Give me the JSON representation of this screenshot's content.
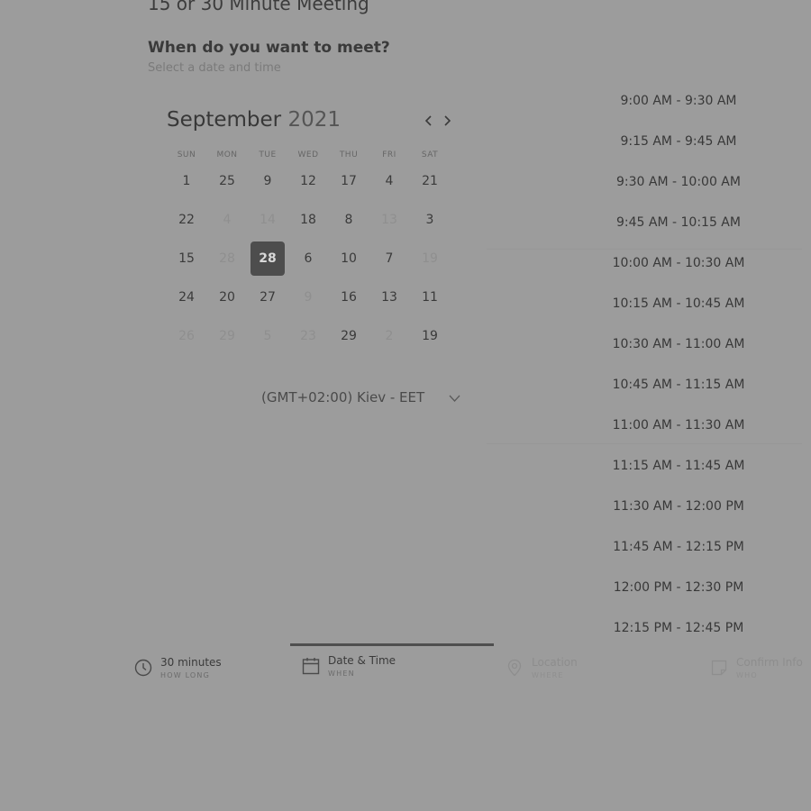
{
  "page": {
    "title": "15 or 30 Minute Meeting",
    "heading": "When do you want to meet?",
    "subheading": "Select a date and time"
  },
  "calendar": {
    "month": "September",
    "year": "2021",
    "weekdays": [
      "SUN",
      "MON",
      "TUE",
      "WED",
      "THU",
      "FRI",
      "SAT"
    ],
    "rows": [
      [
        "1",
        "25",
        "9",
        "12",
        "17",
        "4",
        "21"
      ],
      [
        "22",
        "4",
        "14",
        "18",
        "8",
        "13",
        "3"
      ],
      [
        "15",
        "28",
        "28",
        "6",
        "10",
        "7",
        "19"
      ],
      [
        "24",
        "20",
        "27",
        "9",
        "16",
        "13",
        "11"
      ],
      [
        "26",
        "29",
        "5",
        "23",
        "29",
        "2",
        "19"
      ]
    ],
    "selected_date": "28",
    "timezone": "(GMT+02:00) Kiev - EET"
  },
  "time_slots": [
    "9:00 AM - 9:30 AM",
    "9:15 AM - 9:45 AM",
    "9:30 AM - 10:00 AM",
    "9:45 AM - 10:15 AM",
    "10:00 AM - 10:30 AM",
    "10:15 AM - 10:45 AM",
    "10:30 AM - 11:00 AM",
    "10:45 AM - 11:15 AM",
    "11:00 AM - 11:30 AM",
    "11:15 AM - 11:45 AM",
    "11:30 AM - 12:00 PM",
    "11:45 AM - 12:15 PM",
    "12:00 PM - 12:30 PM",
    "12:15 PM - 12:45 PM"
  ],
  "steps": [
    {
      "title": "30 minutes",
      "subtitle": "HOW LONG",
      "icon": "clock-icon"
    },
    {
      "title": "Date & Time",
      "subtitle": "WHEN",
      "icon": "calendar-icon"
    },
    {
      "title": "Location",
      "subtitle": "WHERE",
      "icon": "location-pin-icon"
    },
    {
      "title": "Confirm Info",
      "subtitle": "WHO",
      "icon": "note-icon"
    }
  ],
  "colors": {
    "overlay_background": "#9c9c9c",
    "selected_date_bg": "#4d4d4d",
    "active_step_bar": "#4f4f4f"
  }
}
